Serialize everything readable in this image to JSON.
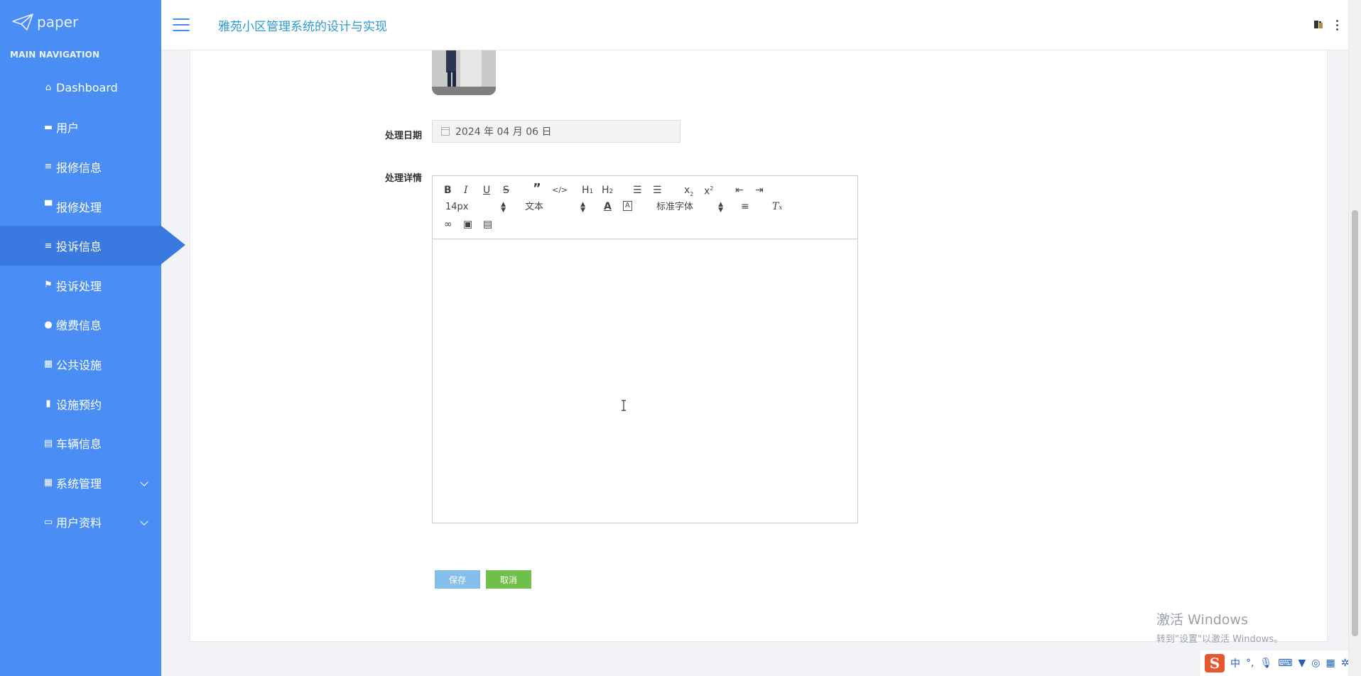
{
  "brand": {
    "name": "paper"
  },
  "sidebar": {
    "header": "MAIN NAVIGATION",
    "items": [
      {
        "label": "Dashboard",
        "icon": "home-icon"
      },
      {
        "label": "用户",
        "icon": "ticket-icon"
      },
      {
        "label": "报修信息",
        "icon": "list-icon"
      },
      {
        "label": "报修处理",
        "icon": "monitor-icon"
      },
      {
        "label": "投诉信息",
        "icon": "list-icon",
        "active": true
      },
      {
        "label": "投诉处理",
        "icon": "flag-icon"
      },
      {
        "label": "缴费信息",
        "icon": "user-icon"
      },
      {
        "label": "公共设施",
        "icon": "grid-icon"
      },
      {
        "label": "设施预约",
        "icon": "book-icon"
      },
      {
        "label": "车辆信息",
        "icon": "clipboard-icon"
      },
      {
        "label": "系统管理",
        "icon": "grid-icon",
        "expandable": true
      },
      {
        "label": "用户资料",
        "icon": "card-icon",
        "expandable": true
      }
    ]
  },
  "header": {
    "title": "雅苑小区管理系统的设计与实现"
  },
  "form": {
    "date_label": "处理日期",
    "date_value": "2024 年 04 月 06 日",
    "detail_label": "处理详情"
  },
  "editor": {
    "font_size": "14px",
    "header_select": "文本",
    "font_family": "标准字体",
    "toolbar_icons": [
      "bold-icon",
      "italic-icon",
      "underline-icon",
      "strike-icon",
      "blockquote-icon",
      "code-icon",
      "h1-icon",
      "h2-icon",
      "ordered-list-icon",
      "bullet-list-icon",
      "subscript-icon",
      "superscript-icon",
      "outdent-icon",
      "indent-icon",
      "font-color-icon",
      "background-color-icon",
      "align-icon",
      "clean-format-icon",
      "link-icon",
      "image-icon",
      "video-icon"
    ]
  },
  "buttons": {
    "save": "保存",
    "cancel": "取消"
  },
  "watermark": {
    "line1": "激活 Windows",
    "line2": "转到\"设置\"以激活 Windows。"
  },
  "ime": {
    "logo": "S",
    "mode": "中",
    "punct": "°,",
    "colors": {
      "logo": "#e8562f",
      "glyphs": "#1f5fb5"
    }
  },
  "colors": {
    "sidebar": "#4a8ef5",
    "sidebar_active": "#3a7ae0",
    "title": "#2b9ad6",
    "save": "#83bfea",
    "cancel": "#6fbf4a"
  }
}
